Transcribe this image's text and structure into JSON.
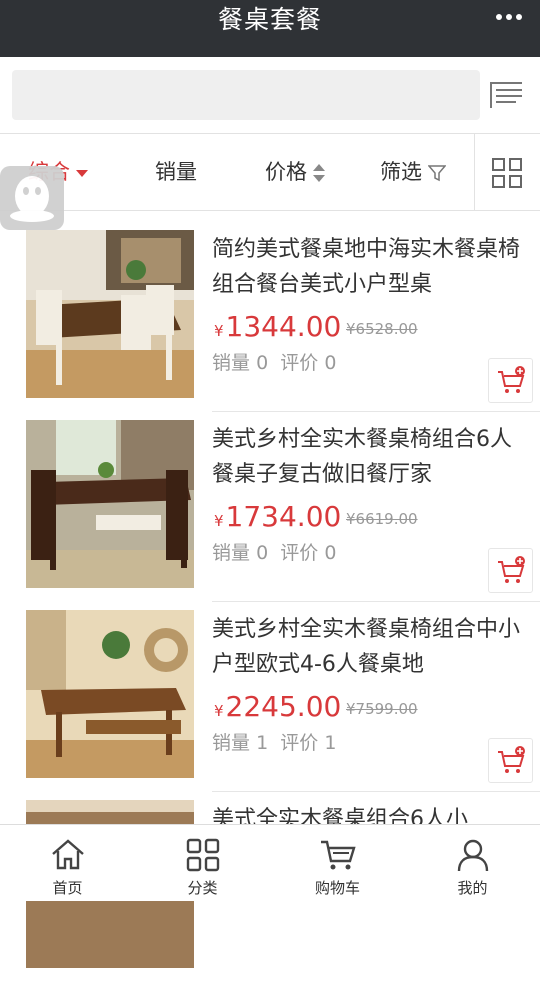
{
  "header": {
    "title": "餐桌套餐",
    "more_icon": "more-dots-icon"
  },
  "search": {
    "placeholder": "",
    "value": ""
  },
  "filters": {
    "items": [
      {
        "label": "综合",
        "active": true,
        "icon": "caret-down-icon"
      },
      {
        "label": "销量",
        "active": false
      },
      {
        "label": "价格",
        "active": false,
        "icon": "sort-updown-icon"
      },
      {
        "label": "筛选",
        "active": false,
        "icon": "funnel-icon"
      }
    ]
  },
  "products": [
    {
      "name": "简约美式餐桌地中海实木餐桌椅组合餐台美式小户型桌",
      "currency": "¥",
      "price": "1344.00",
      "old_price": "¥6528.00",
      "sales_label": "销量",
      "sales": "0",
      "review_label": "评价",
      "reviews": "0"
    },
    {
      "name": "美式乡村全实木餐桌椅组合6人餐桌子复古做旧餐厅家",
      "currency": "¥",
      "price": "1734.00",
      "old_price": "¥6619.00",
      "sales_label": "销量",
      "sales": "0",
      "review_label": "评价",
      "reviews": "0"
    },
    {
      "name": "美式乡村全实木餐桌椅组合中小户型欧式4-6人餐桌地",
      "currency": "¥",
      "price": "2245.00",
      "old_price": "¥7599.00",
      "sales_label": "销量",
      "sales": "1",
      "review_label": "评价",
      "reviews": "1"
    },
    {
      "name": "美式全实木餐桌组合6人小",
      "currency": "",
      "price": "",
      "old_price": "",
      "sales_label": "",
      "sales": "",
      "review_label": "",
      "reviews": ""
    }
  ],
  "bottom_nav": [
    {
      "label": "首页",
      "icon": "home-icon"
    },
    {
      "label": "分类",
      "icon": "category-grid-icon"
    },
    {
      "label": "购物车",
      "icon": "cart-icon"
    },
    {
      "label": "我的",
      "icon": "user-icon"
    }
  ],
  "colors": {
    "accent": "#d8393b",
    "topbar": "#2f3236"
  }
}
